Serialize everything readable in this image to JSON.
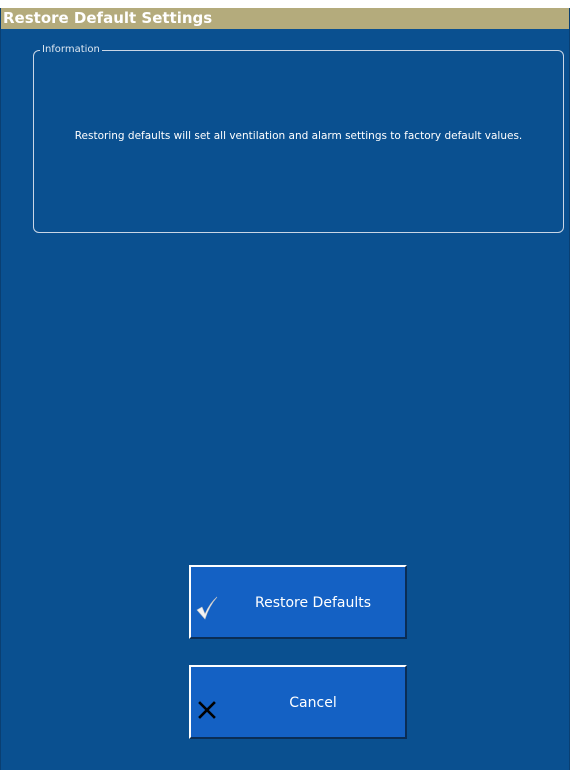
{
  "window": {
    "title": "Restore Default Settings"
  },
  "info_group": {
    "legend": "Information",
    "message": "Restoring defaults will set all ventilation and alarm settings to factory default values."
  },
  "buttons": {
    "restore": {
      "label": "Restore Defaults",
      "icon": "checkmark-icon"
    },
    "cancel": {
      "label": "Cancel",
      "icon": "close-icon"
    }
  },
  "colors": {
    "title_bar": "#b4ab7c",
    "background": "#0a5090",
    "button": "#1461c4"
  }
}
